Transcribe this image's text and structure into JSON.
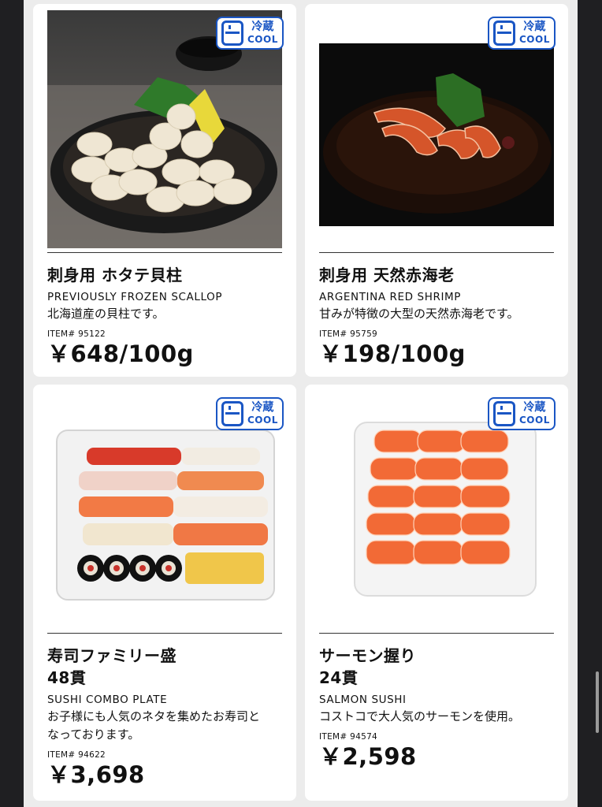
{
  "badge": {
    "jp": "冷蔵",
    "en": "COOL"
  },
  "products": [
    {
      "name_jp": "刺身用 ホタテ貝柱",
      "name_en": "PREVIOUSLY FROZEN SCALLOP",
      "desc": "北海道産の貝柱です。",
      "item": "ITEM# 95122",
      "price": "￥648/100g"
    },
    {
      "name_jp": "刺身用 天然赤海老",
      "name_en": "ARGENTINA RED SHRIMP",
      "desc": "甘みが特徴の大型の天然赤海老です。",
      "item": "ITEM# 95759",
      "price": "￥198/100g"
    },
    {
      "name_jp": "寿司ファミリー盛",
      "count": "48貫",
      "name_en": "SUSHI COMBO PLATE",
      "desc": "お子様にも人気のネタを集めたお寿司と",
      "desc2": "なっております。",
      "item": "ITEM# 94622",
      "price": "￥3,698"
    },
    {
      "name_jp": "サーモン握り",
      "count": "24貫",
      "name_en": "SALMON SUSHI",
      "desc": "コストコで大人気のサーモンを使用。",
      "item": "ITEM# 94574",
      "price": "￥2,598"
    }
  ]
}
